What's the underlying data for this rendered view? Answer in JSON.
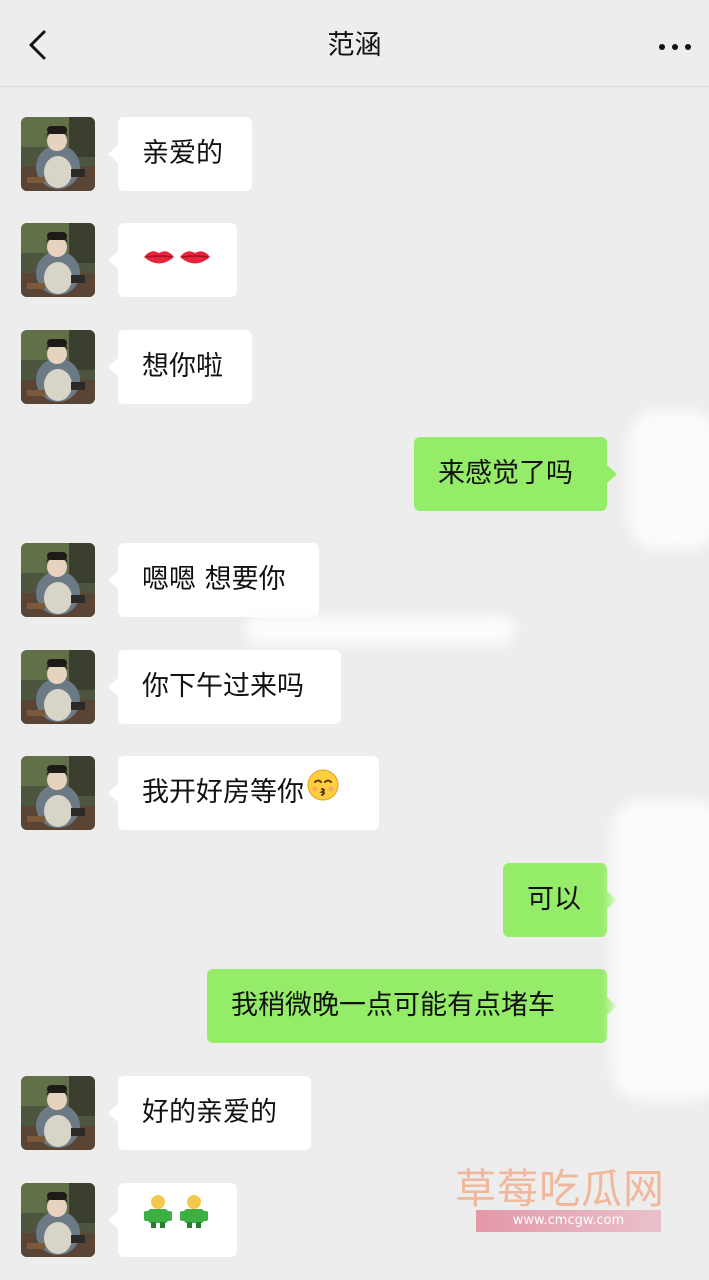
{
  "header": {
    "title": "范涵",
    "back_icon": "chevron-left-icon",
    "more_icon": "more-dots-icon"
  },
  "colors": {
    "background": "#ededed",
    "incoming_bubble": "#ffffff",
    "outgoing_bubble": "#95ec69"
  },
  "messages": [
    {
      "side": "left",
      "text": "亲爱的"
    },
    {
      "side": "left",
      "text": "",
      "emoji": "lips-emoji"
    },
    {
      "side": "left",
      "text": "想你啦"
    },
    {
      "side": "right",
      "text": "来感觉了吗"
    },
    {
      "side": "left",
      "text": "嗯嗯 想要你"
    },
    {
      "side": "left",
      "text": "你下午过来吗"
    },
    {
      "side": "left",
      "text": "我开好房等你",
      "emoji": "kissing-face-emoji"
    },
    {
      "side": "right",
      "text": "可以"
    },
    {
      "side": "right",
      "text": "我稍微晚一点可能有点堵车"
    },
    {
      "side": "left",
      "text": "好的亲爱的"
    },
    {
      "side": "left",
      "text": "",
      "emoji": "green-figure-emoji"
    }
  ],
  "watermark": {
    "title": "草莓吃瓜网",
    "url": "www.cmcgw.com"
  }
}
